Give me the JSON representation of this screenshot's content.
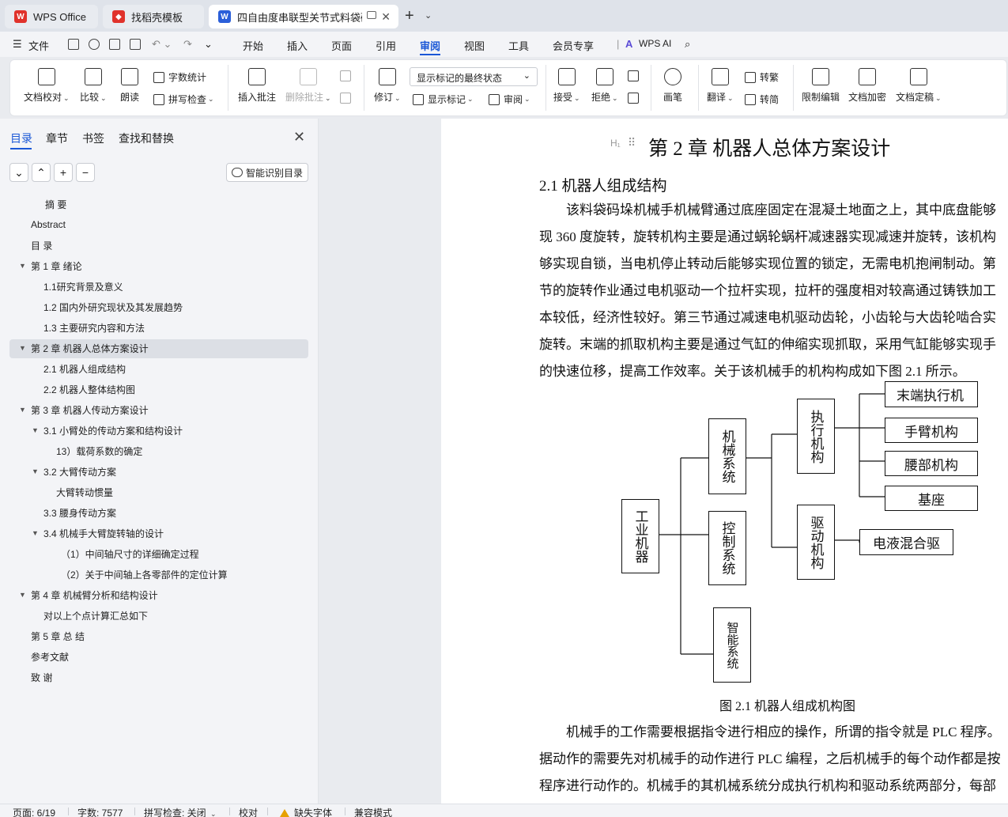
{
  "tabs": [
    {
      "label": "WPS Office",
      "icon": "wps-logo-icon",
      "color": "#e0322b"
    },
    {
      "label": "找稻壳模板",
      "icon": "docer-icon",
      "color": "#e0322b"
    },
    {
      "label": "四自由度串联型关节式料袋码",
      "icon": "word-doc-icon",
      "color": "#2b5fd9"
    }
  ],
  "menu": {
    "file": "文件",
    "items": [
      "开始",
      "插入",
      "页面",
      "引用",
      "审阅",
      "视图",
      "工具",
      "会员专享"
    ],
    "active": "审阅",
    "ai": "WPS AI"
  },
  "ribbon": {
    "doc_check": "文档校对",
    "compare": "比较",
    "read_aloud": "朗读",
    "word_count": "字数统计",
    "spell_check": "拼写检查",
    "insert_comment": "插入批注",
    "delete_comment": "删除批注",
    "revise": "修订",
    "markup_state": "显示标记的最终状态",
    "show_markup": "显示标记",
    "review": "审阅",
    "accept": "接受",
    "reject": "拒绝",
    "pen": "画笔",
    "translate": "翻译",
    "to_traditional": "转繁",
    "to_simplified": "转简",
    "restrict_edit": "限制编辑",
    "encrypt": "文档加密",
    "finalize": "文档定稿"
  },
  "nav": {
    "tabs": [
      "目录",
      "章节",
      "书签",
      "查找和替换"
    ],
    "smart_btn": "智能识别目录",
    "toc": [
      {
        "label": "摘  要",
        "level": 1,
        "tri": false
      },
      {
        "label": "Abstract",
        "level": 0,
        "tri": false
      },
      {
        "label": "目  录",
        "level": 0,
        "tri": false
      },
      {
        "label": "第 1 章   绪论",
        "level": 0,
        "tri": true
      },
      {
        "label": "1.1研究背景及意义",
        "level": 1,
        "tri": false
      },
      {
        "label": "1.2  国内外研究现状及其发展趋势",
        "level": 1,
        "tri": false
      },
      {
        "label": "1.3  主要研究内容和方法",
        "level": 1,
        "tri": false
      },
      {
        "label": "第 2 章   机器人总体方案设计",
        "level": 0,
        "tri": true
      },
      {
        "label": "2.1 机器人组成结构",
        "level": 1,
        "tri": false
      },
      {
        "label": "2.2 机器人整体结构图",
        "level": 1,
        "tri": false
      },
      {
        "label": "第 3 章  机器人传动方案设计",
        "level": 0,
        "tri": true
      },
      {
        "label": "3.1 小臂处的传动方案和结构设计",
        "level": 1,
        "tri": true
      },
      {
        "label": "13）载荷系数的确定",
        "level": 2,
        "tri": false
      },
      {
        "label": "3.2 大臂传动方案",
        "level": 1,
        "tri": true
      },
      {
        "label": "大臂转动惯量",
        "level": 2,
        "tri": false
      },
      {
        "label": "3.3 腰身传动方案",
        "level": 1,
        "tri": false
      },
      {
        "label": "3.4 机械手大臂旋转轴的设计",
        "level": 1,
        "tri": true
      },
      {
        "label": "（1）中间轴尺寸的详细确定过程",
        "level": 3,
        "tri": false
      },
      {
        "label": "（2）关于中间轴上各零部件的定位计算",
        "level": 3,
        "tri": false
      },
      {
        "label": "第 4 章  机械臂分析和结构设计",
        "level": 0,
        "tri": true
      },
      {
        "label": "对以上个点计算汇总如下",
        "level": 1,
        "tri": false
      },
      {
        "label": "第 5 章  总  结",
        "level": 0,
        "tri": false
      },
      {
        "label": "参考文献",
        "level": 0,
        "tri": false
      },
      {
        "label": "致  谢",
        "level": 0,
        "tri": false
      }
    ]
  },
  "doc": {
    "chapter_title": "第 2 章    机器人总体方案设计",
    "section_title": "2.1 机器人组成结构",
    "para1": [
      "　　该料袋码垛机械手机械臂通过底座固定在混凝土地面之上，其中底盘能够",
      "现 360 度旋转，旋转机构主要是通过蜗轮蜗杆减速器实现减速并旋转，该机构",
      "够实现自锁，当电机停止转动后能够实现位置的锁定，无需电机抱闸制动。第",
      "节的旋转作业通过电机驱动一个拉杆实现，拉杆的强度相对较高通过铸铁加工",
      "本较低，经济性较好。第三节通过减速电机驱动齿轮，小齿轮与大齿轮啮合实",
      "旋转。末端的抓取机构主要是通过气缸的伸缩实现抓取，采用气缸能够实现手",
      "的快速位移，提高工作效率。关于该机械手的机构构成如下图 2.1 所示。"
    ],
    "figure": {
      "root": "工业机器",
      "mech": "机械系统",
      "control": "控制系统",
      "smart": "智能系统",
      "exec": "执行机构",
      "drive": "驱动机构",
      "leaves": [
        "末端执行机",
        "手臂机构",
        "腰部机构",
        "基座"
      ],
      "drive_leaf": "电液混合驱"
    },
    "caption": "图 2.1    机器人组成机构图",
    "para2": [
      "　　机械手的工作需要根据指令进行相应的操作，所谓的指令就是 PLC 程序。",
      "据动作的需要先对机械手的动作进行 PLC 编程，之后机械手的每个动作都是按",
      "程序进行动作的。机械手的其机械系统分成执行机构和驱动系统两部分，每部"
    ]
  },
  "status": {
    "page": "页面: 6/19",
    "words": "字数: 7577",
    "spell": "拼写检查: 关闭",
    "proof": "校对",
    "missing_font": "缺失字体",
    "compat": "兼容模式"
  }
}
